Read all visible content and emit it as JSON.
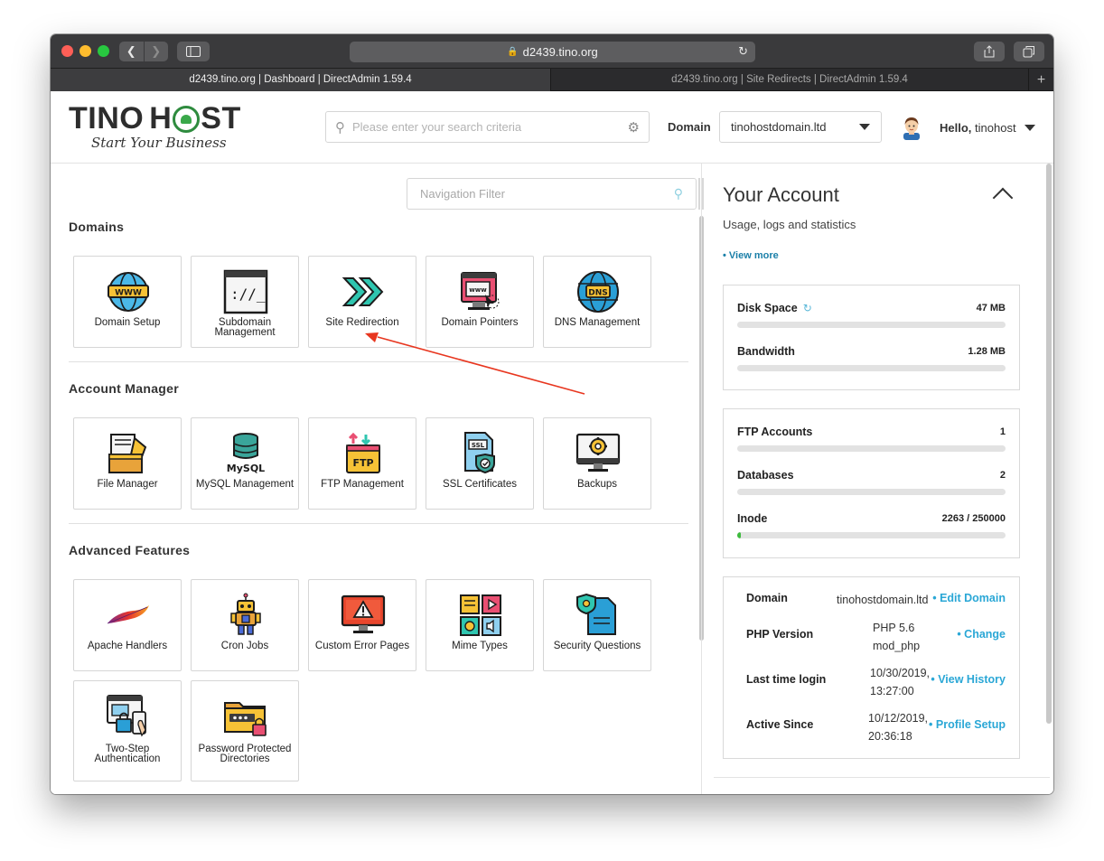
{
  "browser": {
    "address": "d2439.tino.org",
    "tabs": [
      {
        "title": "d2439.tino.org | Dashboard | DirectAdmin 1.59.4"
      },
      {
        "title": "d2439.tino.org | Site Redirects | DirectAdmin 1.59.4"
      }
    ],
    "new_tab": "+"
  },
  "header": {
    "logo_text": "TINOHOST",
    "logo_left": "TINO",
    "logo_h": "H",
    "logo_right": "ST",
    "tagline": "Start Your Business",
    "search_placeholder": "Please enter your search criteria",
    "domain_label": "Domain",
    "domain_value": "tinohostdomain.ltd",
    "hello": "Hello,",
    "username": "tinohost"
  },
  "nav_filter_placeholder": "Navigation Filter",
  "sections": {
    "domains": {
      "title": "Domains",
      "items": [
        {
          "label": "Domain Setup",
          "icon": "globe-www-icon"
        },
        {
          "label": "Subdomain Management",
          "icon": "terminal-window-icon"
        },
        {
          "label": "Site Redirection",
          "icon": "redirect-arrows-icon"
        },
        {
          "label": "Domain Pointers",
          "icon": "browser-pointer-icon"
        },
        {
          "label": "DNS Management",
          "icon": "globe-dns-icon"
        }
      ]
    },
    "account": {
      "title": "Account Manager",
      "items": [
        {
          "label": "File Manager",
          "icon": "folder-files-icon"
        },
        {
          "label": "MySQL Management",
          "icon": "database-mysql-icon"
        },
        {
          "label": "FTP Management",
          "icon": "ftp-folder-icon"
        },
        {
          "label": "SSL Certificates",
          "icon": "ssl-document-icon"
        },
        {
          "label": "Backups",
          "icon": "monitor-gear-icon"
        }
      ]
    },
    "advanced": {
      "title": "Advanced Features",
      "items": [
        {
          "label": "Apache Handlers",
          "icon": "apache-feather-icon"
        },
        {
          "label": "Cron Jobs",
          "icon": "robot-icon"
        },
        {
          "label": "Custom Error Pages",
          "icon": "monitor-warning-icon"
        },
        {
          "label": "Mime Types",
          "icon": "media-types-icon"
        },
        {
          "label": "Security Questions",
          "icon": "security-document-icon"
        },
        {
          "label": "Two-Step Authentication",
          "icon": "two-step-lock-icon"
        },
        {
          "label": "Password Protected Directories",
          "icon": "folder-lock-icon"
        }
      ]
    }
  },
  "account": {
    "title": "Your Account",
    "subtitle": "Usage, logs and statistics",
    "view_more": "• View more",
    "stats_1": [
      {
        "name": "Disk Space",
        "value": "47 MB",
        "fraction": 0.0
      },
      {
        "name": "Bandwidth",
        "value": "1.28 MB",
        "fraction": 0.0
      }
    ],
    "stats_2": [
      {
        "name": "FTP Accounts",
        "value": "1",
        "fraction": 0.0
      },
      {
        "name": "Databases",
        "value": "2",
        "fraction": 0.0
      },
      {
        "name": "Inode",
        "value": "2263 / 250000",
        "fraction": 0.009
      }
    ],
    "info": [
      {
        "key": "Domain",
        "value": "tinohostdomain.ltd",
        "action": "• Edit Domain"
      },
      {
        "key": "PHP Version",
        "value_line1": "PHP 5.6",
        "value_line2": "mod_php",
        "action": "• Change"
      },
      {
        "key": "Last time login",
        "value_line1": "10/30/2019,",
        "value_line2": "13:27:00",
        "action": "• View History"
      },
      {
        "key": "Active Since",
        "value_line1": "10/12/2019,",
        "value_line2": "20:36:18",
        "action": "• Profile Setup"
      }
    ]
  },
  "colors": {
    "link": "#2aa7d6",
    "annotation_arrow": "#e8361f",
    "usage_fill": "#3dbb3d"
  }
}
